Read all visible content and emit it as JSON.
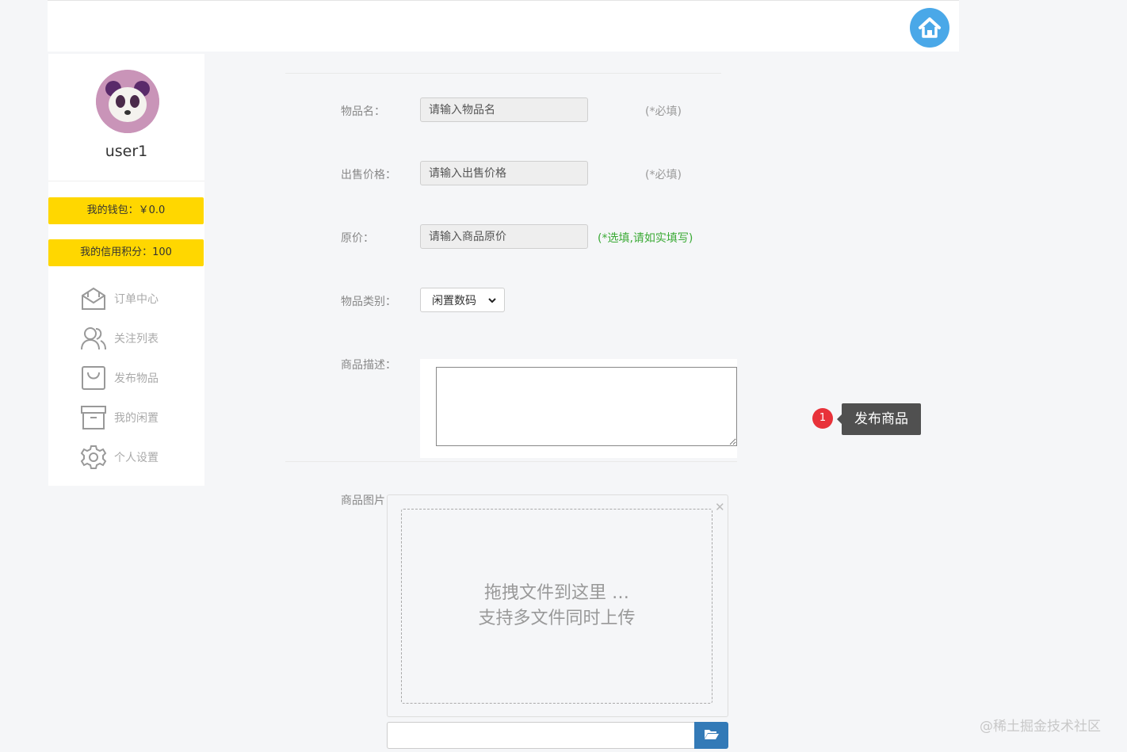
{
  "sidebar": {
    "username": "user1",
    "wallet": "我的钱包：￥0.0",
    "credit": "我的信用积分：100",
    "menu": [
      {
        "label": "订单中心",
        "icon": "mail-icon"
      },
      {
        "label": "关注列表",
        "icon": "users-icon"
      },
      {
        "label": "发布物品",
        "icon": "bag-icon"
      },
      {
        "label": "我的闲置",
        "icon": "archive-icon"
      },
      {
        "label": "个人设置",
        "icon": "gear-icon"
      }
    ]
  },
  "form": {
    "name": {
      "label": "物品名：",
      "placeholder": "请输入物品名",
      "note": "(*必填)"
    },
    "price": {
      "label": "出售价格：",
      "placeholder": "请输入出售价格",
      "note": "(*必填)"
    },
    "original": {
      "label": "原价：",
      "placeholder": "请输入商品原价",
      "note": "(*选填,请如实填写)"
    },
    "category": {
      "label": "物品类别：",
      "value": "闲置数码"
    },
    "description": {
      "label": "商品描述："
    },
    "images": {
      "label": "商品图片：",
      "drop_line1": "拖拽文件到这里 …",
      "drop_line2": "支持多文件同时上传"
    }
  },
  "tooltip": {
    "badge": "1",
    "text": "发布商品"
  },
  "watermark": "@稀土掘金技术社区",
  "colors": {
    "accent_yellow": "#ffd700",
    "home_blue": "#4aa8e8",
    "note_green": "#3aaa35",
    "badge_red": "#e8323a"
  }
}
